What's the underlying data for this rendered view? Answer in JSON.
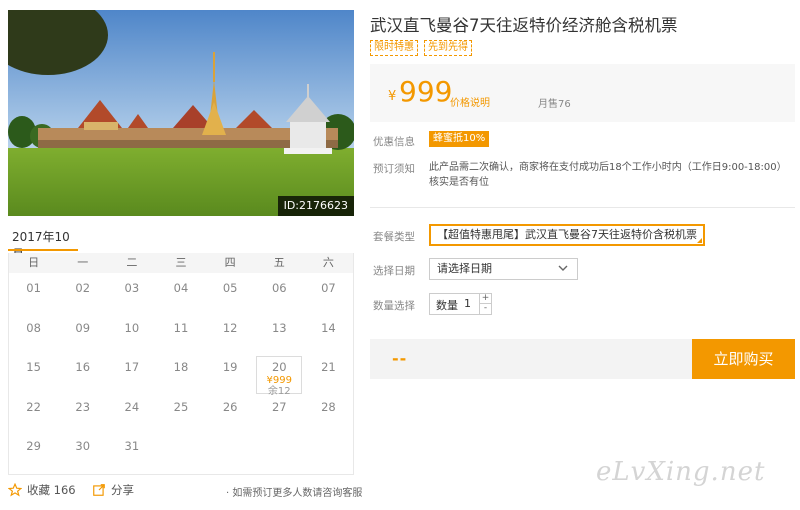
{
  "hero": {
    "id_badge": "ID:2176623"
  },
  "calendar": {
    "month": "2017年10月",
    "weekdays": [
      "日",
      "一",
      "二",
      "三",
      "四",
      "五",
      "六"
    ],
    "rows": [
      [
        "01",
        "02",
        "03",
        "04",
        "05",
        "06",
        "07"
      ],
      [
        "08",
        "09",
        "10",
        "11",
        "12",
        "13",
        "14"
      ],
      [
        "15",
        "16",
        "17",
        "18",
        "19",
        "20",
        "21"
      ],
      [
        "22",
        "23",
        "24",
        "25",
        "26",
        "27",
        "28"
      ],
      [
        "29",
        "30",
        "31",
        "",
        "",
        "",
        ""
      ]
    ],
    "available": {
      "day": "20",
      "price": "¥999",
      "stock": "余12"
    }
  },
  "actions": {
    "favorite": "收藏 166",
    "share": "分享",
    "consult": "· 如需预订更多人数请咨询客服"
  },
  "product": {
    "title": "武汉直飞曼谷7天往返特价经济舱含税机票",
    "tags": [
      "限时特惠",
      "先到先得"
    ],
    "currency": "¥",
    "price": "999",
    "price_note": "价格说明",
    "sold": "月售76"
  },
  "info": {
    "discount_label": "优惠信息",
    "discount_value": "蜂蜜抵10%",
    "notice_label": "预订须知",
    "notice_text": "此产品需二次确认，商家将在支付成功后18个工作小时内（工作日9:00-18:00）核实是否有位"
  },
  "form": {
    "package_label": "套餐类型",
    "package_value": "【超值特惠甩尾】武汉直飞曼谷7天往返特价含税机票",
    "date_label": "选择日期",
    "date_value": "请选择日期",
    "qty_label": "数量选择",
    "qty_prefix": "数量",
    "qty_value": "1",
    "plus": "+",
    "minus": "-"
  },
  "purchase": {
    "total": "--",
    "buy_label": "立即购买"
  },
  "watermark": "eLvXing.net",
  "colors": {
    "accent": "#f39800"
  }
}
